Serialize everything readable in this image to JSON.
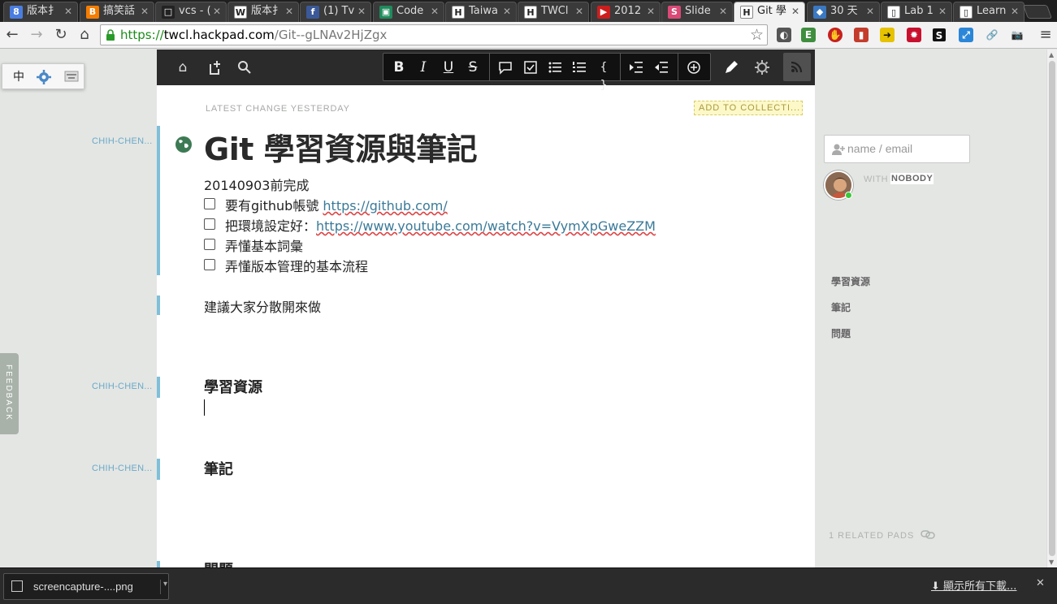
{
  "browser": {
    "tabs": [
      {
        "title": "版本扌",
        "icon": "google-icon",
        "color": "#4a7de0",
        "glyph": "8"
      },
      {
        "title": "搞笑話",
        "icon": "blogger-icon",
        "color": "#f57d00",
        "glyph": "B"
      },
      {
        "title": "vcs - (",
        "icon": "page-icon",
        "color": "#222222",
        "glyph": "□"
      },
      {
        "title": "版本扌",
        "icon": "wikipedia-icon",
        "color": "#ffffff",
        "glyph": "W"
      },
      {
        "title": "(1) Tv",
        "icon": "facebook-icon",
        "color": "#3b5998",
        "glyph": "f"
      },
      {
        "title": "Code",
        "icon": "codeschool-icon",
        "color": "#1f8a5b",
        "glyph": "▣"
      },
      {
        "title": "Taiwa",
        "icon": "hackpad-icon",
        "color": "#ffffff",
        "glyph": "H"
      },
      {
        "title": "TWCl",
        "icon": "hackpad-icon",
        "color": "#ffffff",
        "glyph": "H"
      },
      {
        "title": "2012",
        "icon": "youtube-icon",
        "color": "#cc1e1e",
        "glyph": "▶"
      },
      {
        "title": "Slide",
        "icon": "slideshare-icon",
        "color": "#d94a77",
        "glyph": "S"
      },
      {
        "title": "Git 學",
        "icon": "hackpad-icon",
        "color": "#ffffff",
        "glyph": "H",
        "active": true
      },
      {
        "title": "30 天",
        "icon": "ironman-icon",
        "color": "#3a78c2",
        "glyph": "◆"
      },
      {
        "title": "Lab 1",
        "icon": "doc-icon",
        "color": "#ffffff",
        "glyph": "▯"
      },
      {
        "title": "Learn",
        "icon": "doc-icon",
        "color": "#ffffff",
        "glyph": "▯"
      }
    ],
    "url": {
      "scheme": "https://",
      "host": "twcl.hackpad.com",
      "path": "/Git--gLNAv2HjZgx"
    }
  },
  "ime": {
    "mode": "中"
  },
  "feedback_label": "FEEDBACK",
  "authors": [
    "CHIH-CHEN...",
    "CHIH-CHEN...",
    "CHIH-CHEN..."
  ],
  "pad": {
    "latest_change": "LATEST CHANGE YESTERDAY",
    "add_to_collection": "ADD TO COLLECTI...",
    "title": "Git 學習資源與筆記",
    "intro": "20140903前完成",
    "tasks": [
      {
        "text": "要有github帳號 ",
        "link": "https://github.com/"
      },
      {
        "text": "把環境設定好：",
        "link": "https://www.youtube.com/watch?v=VymXpGweZZM"
      },
      {
        "text": "弄懂基本詞彙",
        "link": ""
      },
      {
        "text": "弄懂版本管理的基本流程",
        "link": ""
      }
    ],
    "suggestion": "建議大家分散開來做",
    "headings": [
      "學習資源",
      "筆記",
      "問題"
    ]
  },
  "sidebar": {
    "invite_placeholder": "name / email",
    "with_label": "WITH",
    "with_value": "NOBODY",
    "toc": [
      "學習資源",
      "筆記",
      "問題"
    ],
    "related": "1 RELATED PADS"
  },
  "downloads": {
    "file": "screencapture-....png",
    "show_all": "顯示所有下載..."
  },
  "colors": {
    "accent_blue": "#7fbfd9",
    "link": "#3a7a98",
    "toolbar_dark": "#2b2b2b",
    "online": "#39c83a"
  }
}
